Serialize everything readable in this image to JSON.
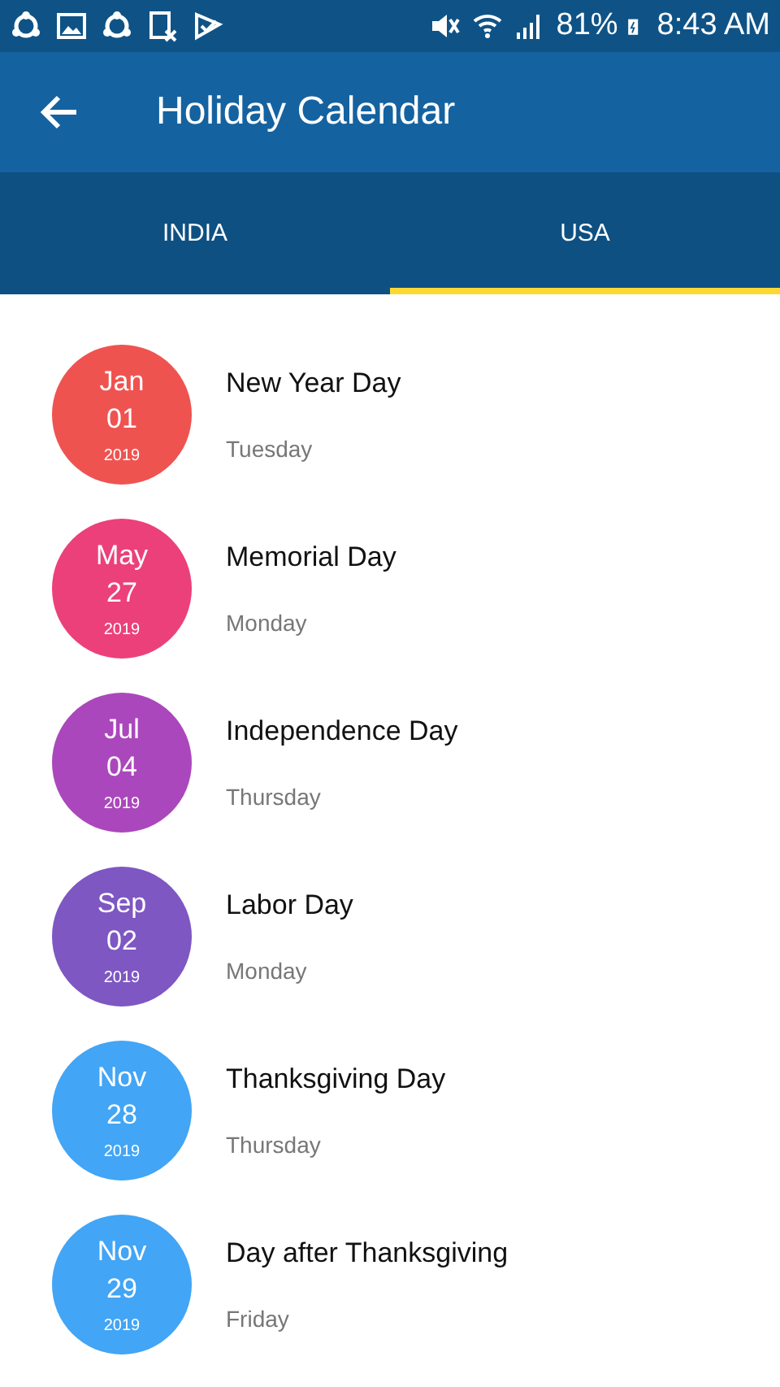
{
  "status_bar": {
    "battery": "81%",
    "time": "8:43 AM"
  },
  "app_bar": {
    "title": "Holiday Calendar"
  },
  "tabs": [
    {
      "label": "INDIA",
      "selected": false
    },
    {
      "label": "USA",
      "selected": true
    }
  ],
  "holidays": [
    {
      "month": "Jan",
      "day": "01",
      "year": "2019",
      "name": "New Year Day",
      "weekday": "Tuesday",
      "color": "#ef5350"
    },
    {
      "month": "May",
      "day": "27",
      "year": "2019",
      "name": "Memorial Day",
      "weekday": "Monday",
      "color": "#ec407a"
    },
    {
      "month": "Jul",
      "day": "04",
      "year": "2019",
      "name": "Independence Day",
      "weekday": "Thursday",
      "color": "#ab47bc"
    },
    {
      "month": "Sep",
      "day": "02",
      "year": "2019",
      "name": "Labor Day",
      "weekday": "Monday",
      "color": "#7e57c2"
    },
    {
      "month": "Nov",
      "day": "28",
      "year": "2019",
      "name": "Thanksgiving Day",
      "weekday": "Thursday",
      "color": "#42a5f5"
    },
    {
      "month": "Nov",
      "day": "29",
      "year": "2019",
      "name": "Day after Thanksgiving",
      "weekday": "Friday",
      "color": "#42a5f5"
    }
  ]
}
